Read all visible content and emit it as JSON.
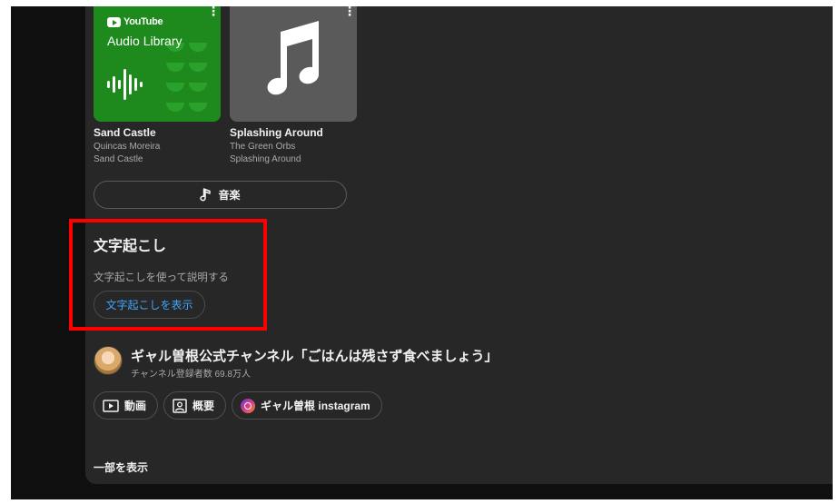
{
  "music_cards": [
    {
      "title": "Sand Castle",
      "artist": "Quincas Moreira",
      "album": "Sand Castle",
      "thumb_logo": "YouTube",
      "thumb_caption": "Audio Library",
      "color": "#1e8a1e"
    },
    {
      "title": "Splashing Around",
      "artist": "The Green Orbs",
      "album": "Splashing Around",
      "color": "#5a5a5a"
    }
  ],
  "music_button": {
    "label": "音楽",
    "icon": "music-note-icon"
  },
  "transcript": {
    "heading": "文字起こし",
    "description": "文字起こしを使って説明する",
    "button_label": "文字起こしを表示"
  },
  "channel": {
    "name": "ギャル曽根公式チャンネル「ごはんは残さず食べましょう」",
    "subscribers": "チャンネル登録者数 69.8万人"
  },
  "chips": [
    {
      "label": "動画",
      "icon": "video-icon"
    },
    {
      "label": "概要",
      "icon": "profile-icon"
    },
    {
      "label": "ギャル曽根 instagram",
      "icon": "instagram-icon"
    }
  ],
  "show_less_label": "一部を表示",
  "colors": {
    "panel_bg": "#272727",
    "page_bg": "#0f0f0f",
    "link_blue": "#3ea6ff",
    "highlight_red": "#ff0000"
  }
}
